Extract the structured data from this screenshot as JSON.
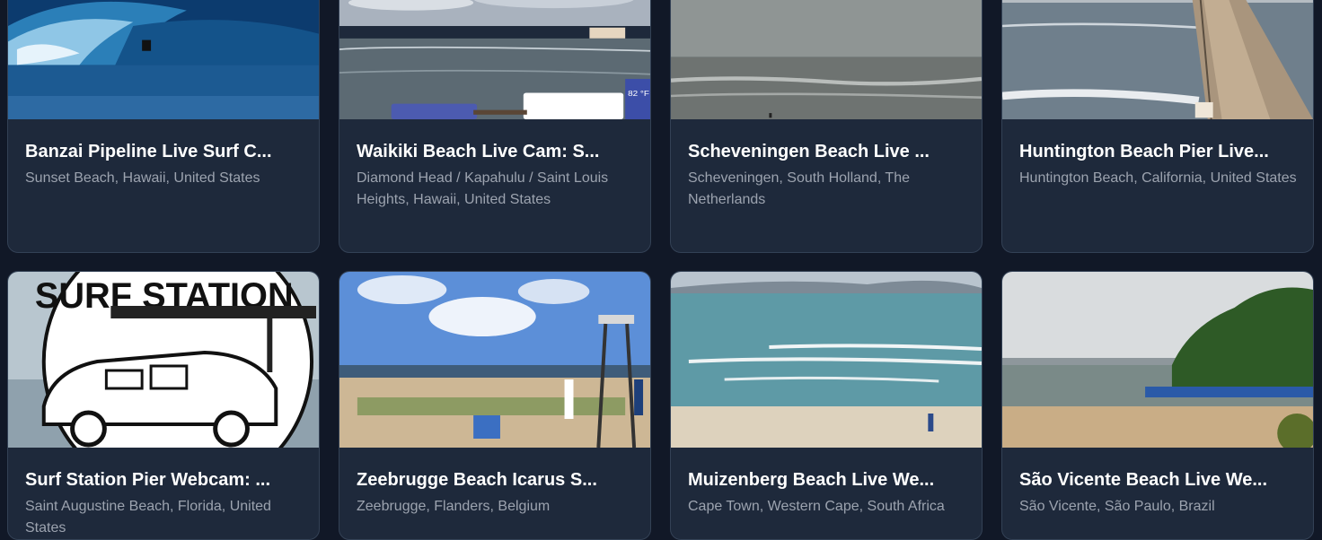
{
  "cards": [
    {
      "title": "Banzai Pipeline Live Surf C...",
      "location": "Sunset Beach, Hawaii, United States"
    },
    {
      "title": "Waikiki Beach Live Cam: S...",
      "location": "Diamond Head / Kapahulu / Saint Louis Heights, Hawaii, United States"
    },
    {
      "title": "Scheveningen Beach Live ...",
      "location": "Scheveningen, South Holland, The Netherlands"
    },
    {
      "title": "Huntington Beach Pier Live...",
      "location": "Huntington Beach, California, United States"
    },
    {
      "title": "Surf Station Pier Webcam: ...",
      "location": "Saint Augustine Beach, Florida, United States"
    },
    {
      "title": "Zeebrugge Beach Icarus S...",
      "location": "Zeebrugge, Flanders, Belgium"
    },
    {
      "title": "Muizenberg Beach Live We...",
      "location": "Cape Town, Western Cape, South Africa"
    },
    {
      "title": "São Vicente Beach Live We...",
      "location": "São Vicente, São Paulo, Brazil"
    }
  ],
  "thumbnails": {
    "overlay_temp": "82 °F",
    "logo_text": "SURF STATION"
  },
  "colors": {
    "background": "#111827",
    "card": "#1e293b",
    "title": "#ffffff",
    "subtitle": "#9ca3af"
  }
}
